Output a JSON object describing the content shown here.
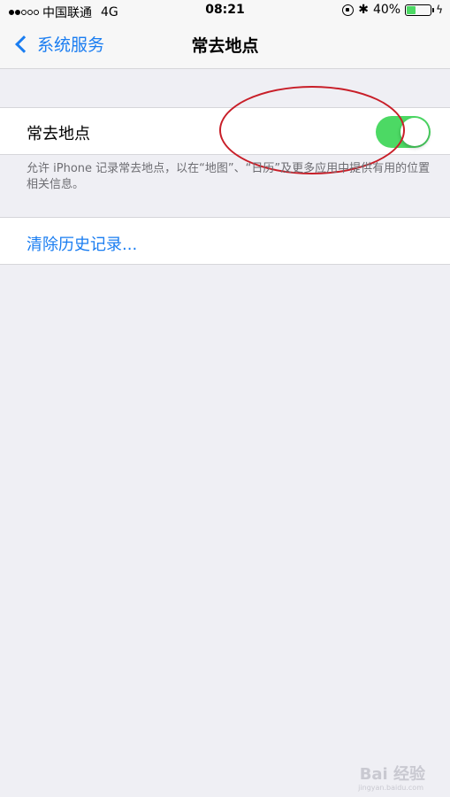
{
  "status_bar": {
    "signal_filled": 2,
    "signal_total": 5,
    "carrier": "中国联通",
    "network": "4G",
    "time": "08:21",
    "battery_percent": "40%",
    "battery_level": 0.4,
    "icons": [
      "rotation-lock-icon",
      "bluetooth-icon",
      "battery-icon",
      "charging-icon"
    ]
  },
  "nav": {
    "back_label": "系统服务",
    "title": "常去地点"
  },
  "toggle_cell": {
    "label": "常去地点",
    "enabled": true,
    "accent_color": "#4cd964"
  },
  "footer": {
    "text": "允许 iPhone 记录常去地点，以在“地图”、“日历”及更多应用中提供有用的位置相关信息。"
  },
  "clear_cell": {
    "label": "清除历史记录..."
  },
  "watermark": {
    "text": "Bai 经验",
    "sub": "jingyan.baidu.com"
  },
  "colors": {
    "link": "#1a7df1",
    "background": "#efeff4",
    "annotation": "#c81e28"
  }
}
